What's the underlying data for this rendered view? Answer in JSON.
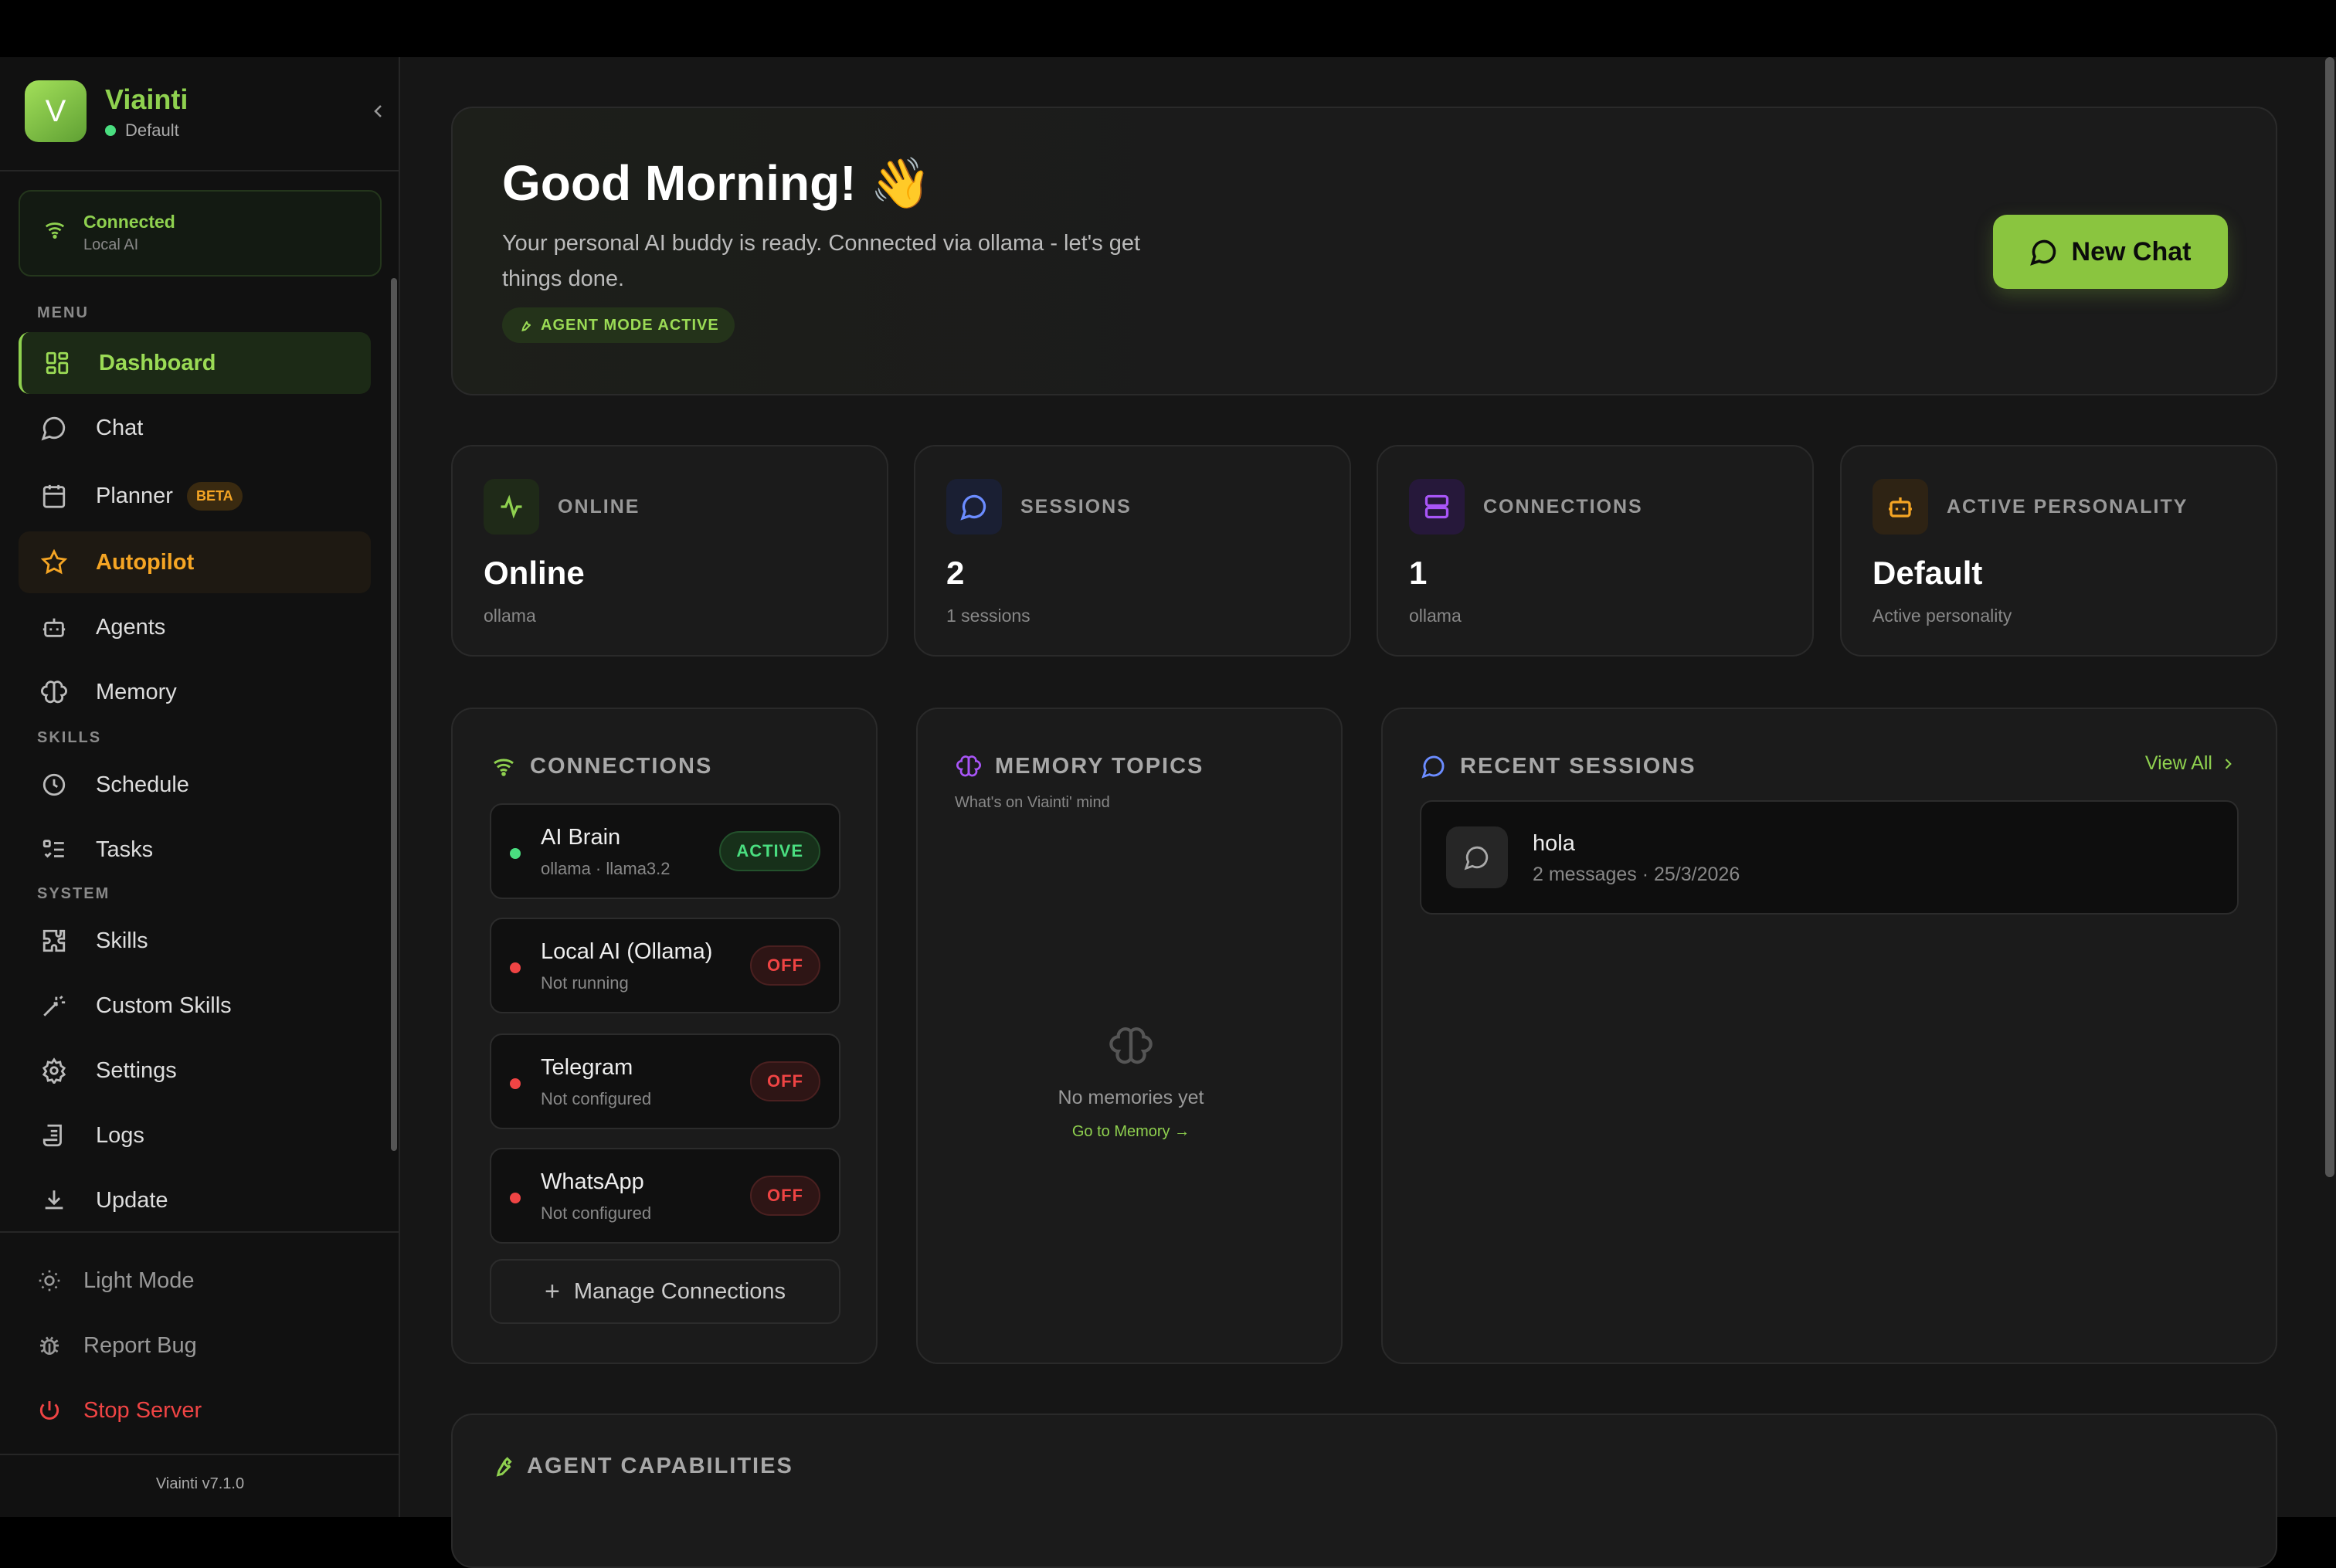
{
  "brand": {
    "name": "Viainti",
    "logo_letter": "V",
    "personality": "Default"
  },
  "connection_status": {
    "title": "Connected",
    "subtitle": "Local AI"
  },
  "sections": {
    "menu": "MENU",
    "skills": "SKILLS",
    "system": "SYSTEM"
  },
  "nav": {
    "dashboard": "Dashboard",
    "chat": "Chat",
    "planner": "Planner",
    "planner_badge": "BETA",
    "autopilot": "Autopilot",
    "agents": "Agents",
    "memory": "Memory",
    "schedule": "Schedule",
    "tasks": "Tasks",
    "skills": "Skills",
    "custom_skills": "Custom Skills",
    "settings": "Settings",
    "logs": "Logs",
    "update": "Update"
  },
  "footer": {
    "light_mode": "Light Mode",
    "report_bug": "Report Bug",
    "stop_server": "Stop Server",
    "version": "Viainti v7.1.0"
  },
  "hero": {
    "title": "Good Morning! 👋",
    "description": "Your personal AI buddy is ready. Connected via ollama - let's get things done.",
    "badge": "AGENT MODE ACTIVE",
    "new_chat": "New Chat"
  },
  "stats": [
    {
      "label": "ONLINE",
      "value": "Online",
      "sub": "ollama"
    },
    {
      "label": "SESSIONS",
      "value": "2",
      "sub": "1 sessions"
    },
    {
      "label": "CONNECTIONS",
      "value": "1",
      "sub": "ollama"
    },
    {
      "label": "ACTIVE PERSONALITY",
      "value": "Default",
      "sub": "Active personality"
    }
  ],
  "connections_panel": {
    "title": "CONNECTIONS",
    "items": [
      {
        "name": "AI Brain",
        "sub": "ollama · llama3.2",
        "status": "ACTIVE"
      },
      {
        "name": "Local AI (Ollama)",
        "sub": "Not running",
        "status": "OFF"
      },
      {
        "name": "Telegram",
        "sub": "Not configured",
        "status": "OFF"
      },
      {
        "name": "WhatsApp",
        "sub": "Not configured",
        "status": "OFF"
      }
    ],
    "manage": "Manage Connections"
  },
  "memory_panel": {
    "title": "MEMORY TOPICS",
    "subtitle": "What's on Viainti' mind",
    "empty": "No memories yet",
    "link": "Go to Memory →"
  },
  "sessions_panel": {
    "title": "RECENT SESSIONS",
    "view_all": "View All",
    "items": [
      {
        "name": "hola",
        "meta": "2 messages · 25/3/2026"
      }
    ]
  },
  "capabilities": {
    "title": "AGENT CAPABILITIES"
  },
  "colors": {
    "accent": "#8fd14f",
    "autopilot": "#f5a524",
    "danger": "#ef4444",
    "success": "#4ade80"
  }
}
